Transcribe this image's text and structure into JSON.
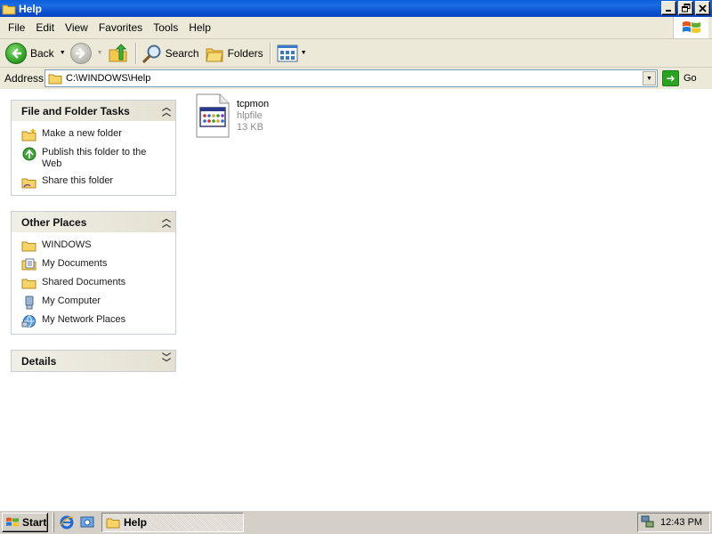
{
  "window": {
    "title": "Help"
  },
  "menu": [
    "File",
    "Edit",
    "View",
    "Favorites",
    "Tools",
    "Help"
  ],
  "toolbar": {
    "back_label": "Back",
    "search_label": "Search",
    "folders_label": "Folders"
  },
  "address": {
    "label": "Address",
    "value": "C:\\WINDOWS\\Help",
    "go_label": "Go"
  },
  "panels": {
    "file_tasks": {
      "title": "File and Folder Tasks",
      "items": [
        {
          "label": "Make a new folder",
          "icon": "new-folder-icon"
        },
        {
          "label": "Publish this folder to the Web",
          "icon": "publish-web-icon"
        },
        {
          "label": "Share this folder",
          "icon": "share-folder-icon"
        }
      ]
    },
    "other_places": {
      "title": "Other Places",
      "items": [
        {
          "label": "WINDOWS",
          "icon": "folder-icon"
        },
        {
          "label": "My Documents",
          "icon": "my-documents-icon"
        },
        {
          "label": "Shared Documents",
          "icon": "folder-icon"
        },
        {
          "label": "My Computer",
          "icon": "my-computer-icon"
        },
        {
          "label": "My Network Places",
          "icon": "network-places-icon"
        }
      ]
    },
    "details": {
      "title": "Details"
    }
  },
  "files": [
    {
      "name": "tcpmon",
      "type": "hlpfile",
      "size": "13 KB"
    }
  ],
  "taskbar": {
    "start_label": "Start",
    "task_label": "Help",
    "clock": "12:43 PM"
  },
  "colors": {
    "titlebar": "#0A5FD8",
    "panel_bg": "#FFFFFF",
    "chrome": "#ECE9D8"
  }
}
